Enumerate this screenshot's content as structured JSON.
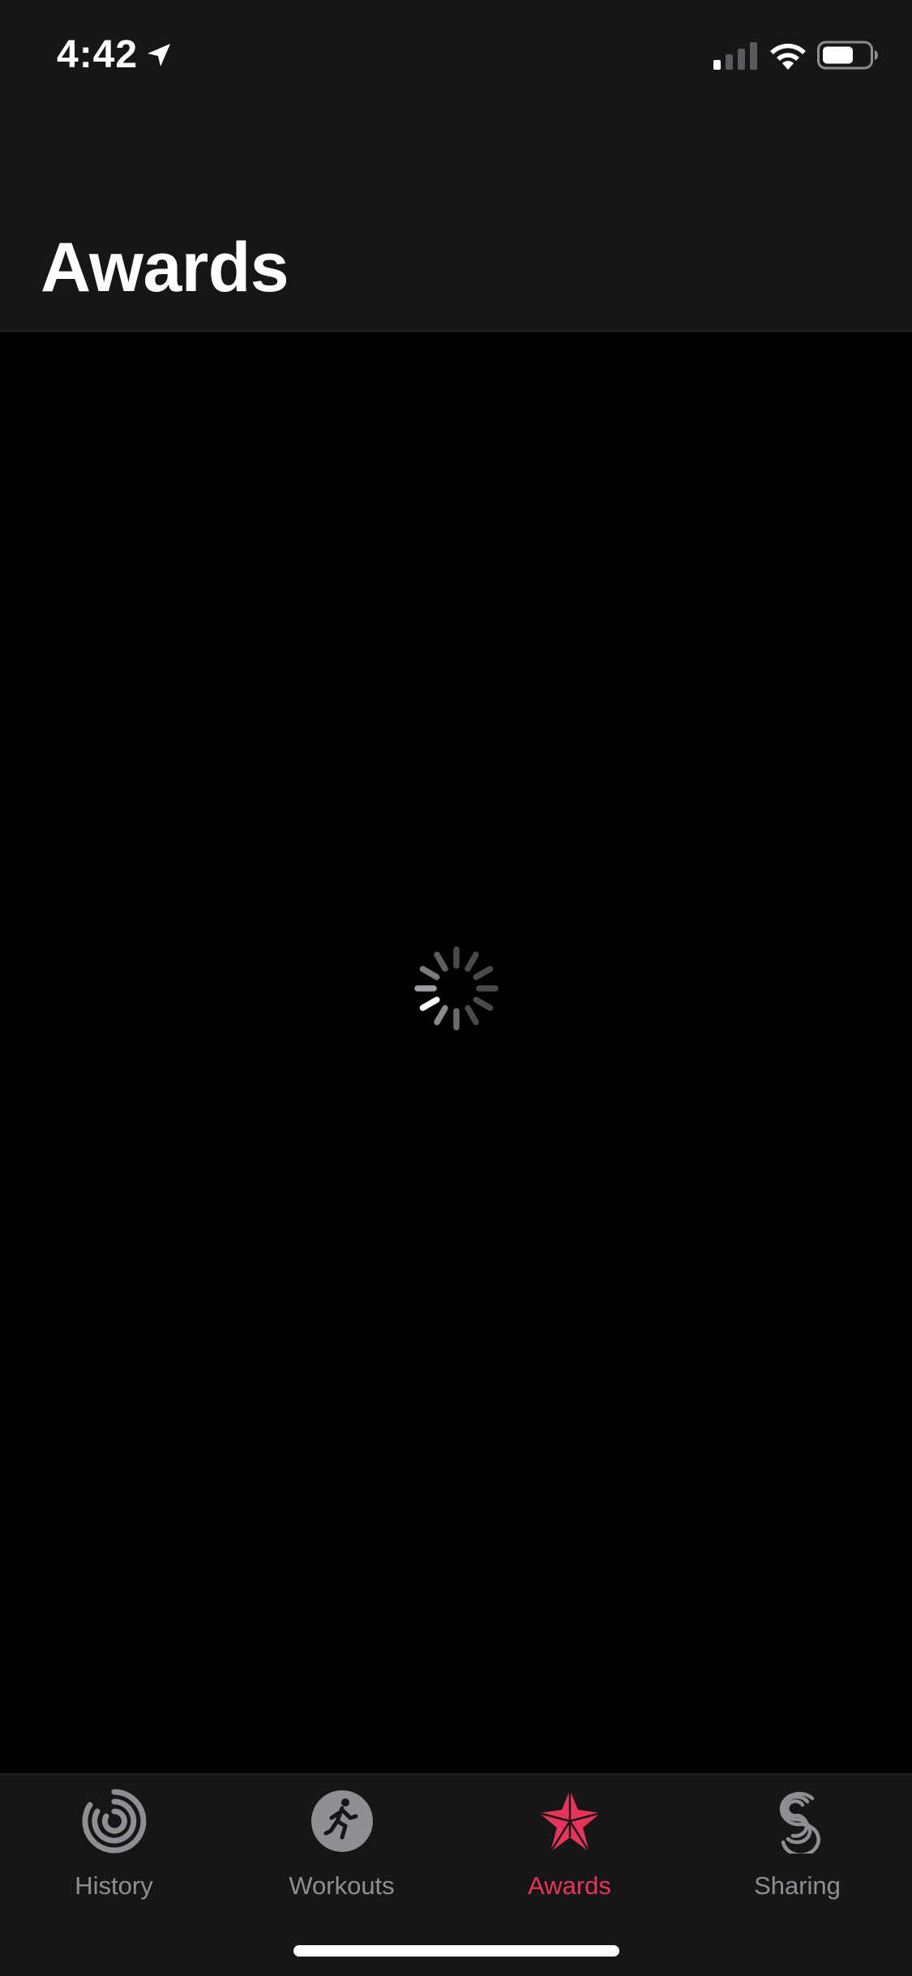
{
  "status_bar": {
    "time": "4:42",
    "icons": [
      "location-arrow-icon",
      "cellular-signal-icon",
      "wifi-icon",
      "battery-icon"
    ]
  },
  "header": {
    "title": "Awards"
  },
  "content": {
    "loading": true,
    "icon": "loading-spinner-icon"
  },
  "tab_bar": {
    "tabs": [
      {
        "label": "History",
        "icon": "activity-rings-icon",
        "active": false
      },
      {
        "label": "Workouts",
        "icon": "running-figure-icon",
        "active": false
      },
      {
        "label": "Awards",
        "icon": "star-award-icon",
        "active": true
      },
      {
        "label": "Sharing",
        "icon": "sharing-icon",
        "active": false
      }
    ]
  },
  "colors": {
    "background": "#000000",
    "bar_background": "#161617",
    "accent": "#e8345a",
    "inactive": "#8e8e93",
    "text": "#ffffff"
  }
}
